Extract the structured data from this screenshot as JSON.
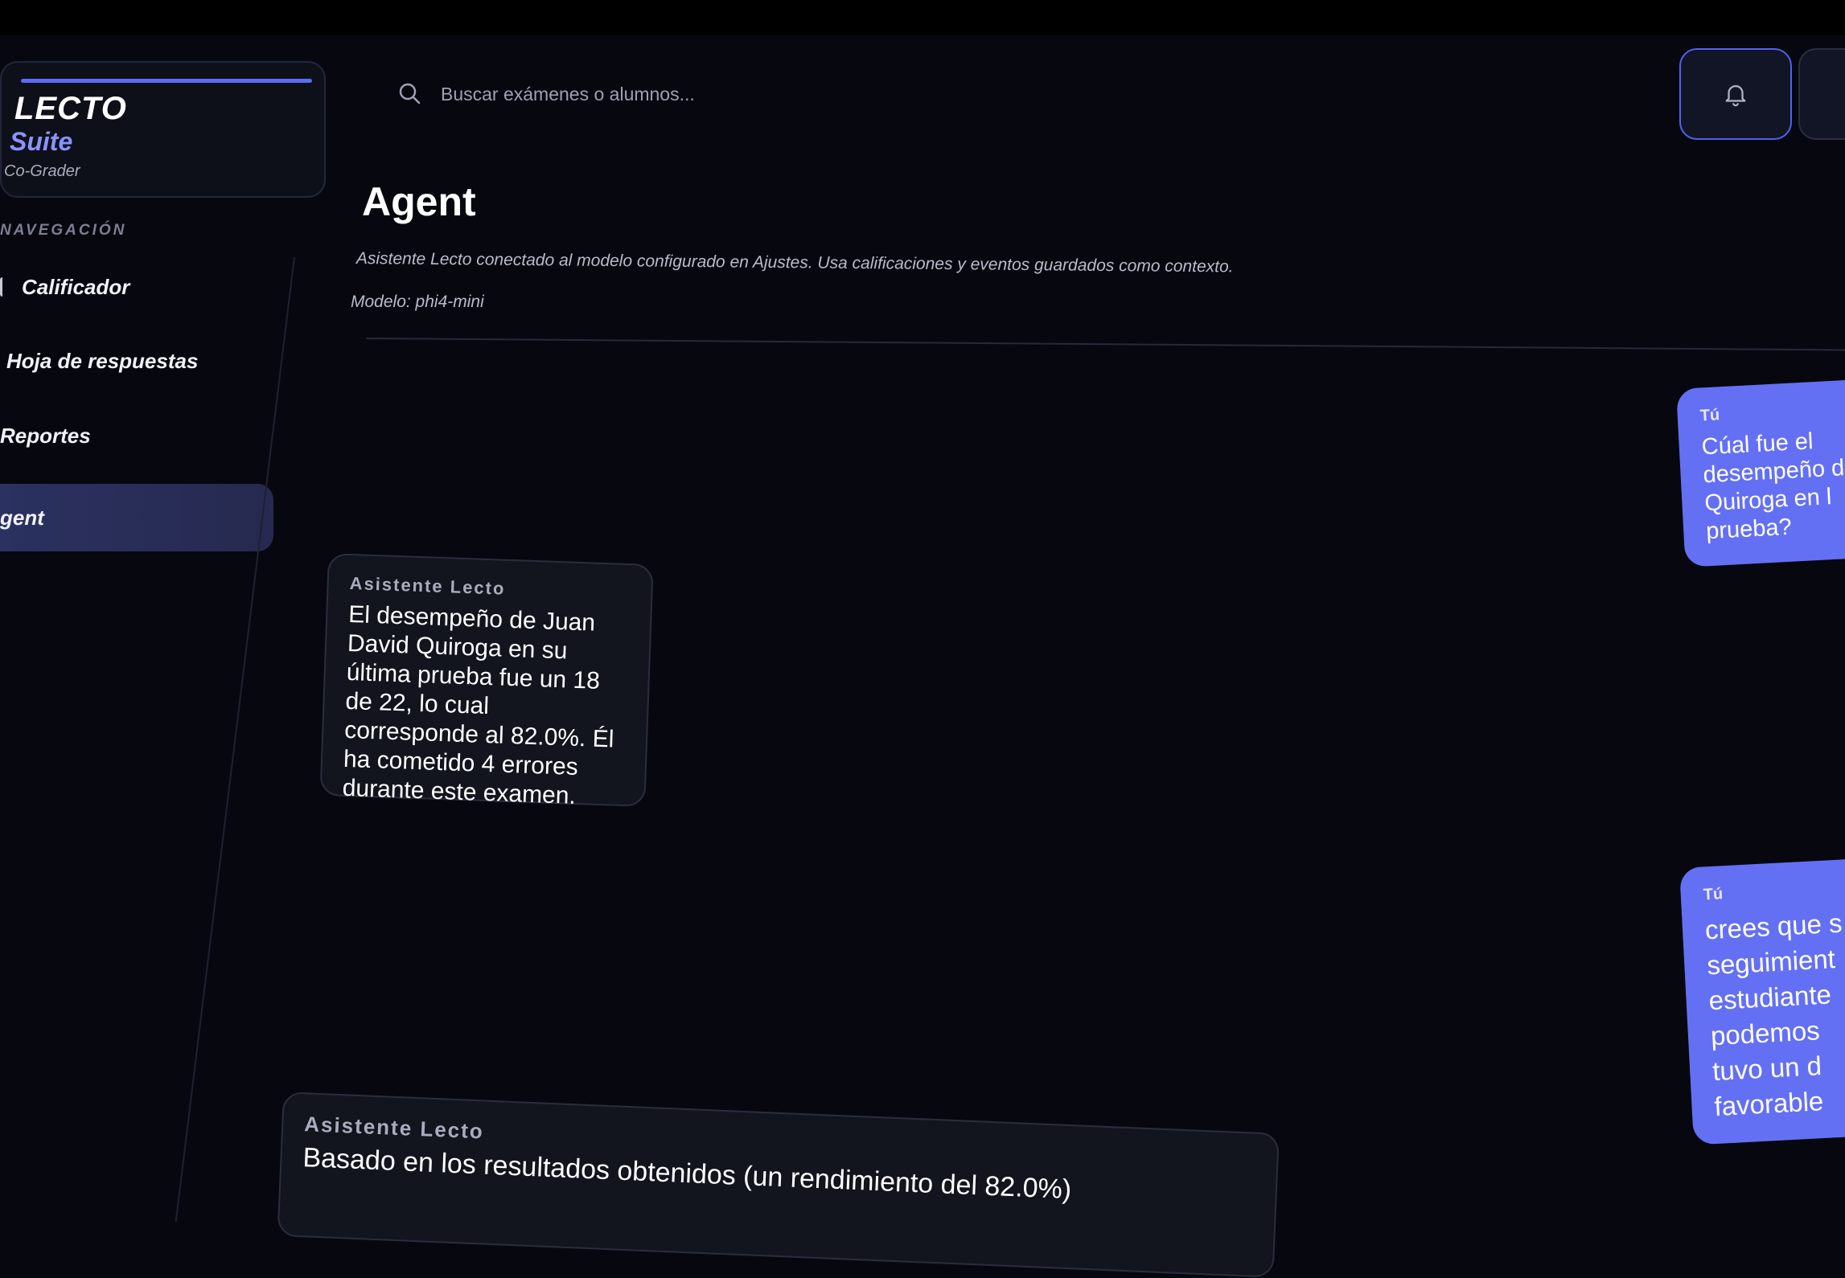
{
  "brand": {
    "title": "LECTO",
    "subtitle": "Suite",
    "tagline": "Co-Grader"
  },
  "sidebar": {
    "heading": "NAVEGACIÓN",
    "items": [
      {
        "label": "Calificador"
      },
      {
        "label": "Hoja de respuestas"
      },
      {
        "label": "Reportes"
      },
      {
        "label": "gent"
      }
    ]
  },
  "search": {
    "placeholder": "Buscar exámenes o alumnos..."
  },
  "header": {
    "title": "Agent",
    "description": "Asistente Lecto conectado al modelo configurado en Ajustes. Usa calificaciones y eventos guardados como contexto.",
    "model": "Modelo: phi4-mini"
  },
  "chat": {
    "messages": [
      {
        "sender": "Tú",
        "text": "Cúal fue el desempeño d Quiroga en l prueba?"
      },
      {
        "sender": "Asistente Lecto",
        "text": "El desempeño de Juan David Quiroga en su última prueba fue un 18 de 22, lo cual corresponde al 82.0%. Él ha cometido 4 errores durante este examen."
      },
      {
        "sender": "Tú",
        "text": "crees que s seguimient estudiante podemos tuvo un d favorable"
      },
      {
        "sender": "Asistente Lecto",
        "text": "Basado en los resultados obtenidos (un rendimiento del 82.0%)"
      }
    ]
  },
  "colors": {
    "accent": "#6470f3",
    "background": "#07080f",
    "panel": "#12141e"
  },
  "icons": {
    "search": "search-icon",
    "notifications": "bell-icon",
    "settings": "gear-icon"
  }
}
